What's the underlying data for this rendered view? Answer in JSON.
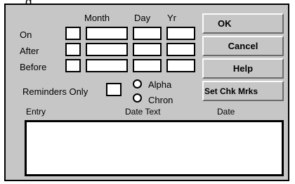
{
  "window": {
    "title_fragment": "g"
  },
  "columns": {
    "month": "Month",
    "day": "Day",
    "year": "Yr"
  },
  "rows": {
    "on": "On",
    "after": "After",
    "before": "Before"
  },
  "inputs": {
    "on": {
      "month": "",
      "day": "",
      "year": ""
    },
    "after": {
      "month": "",
      "day": "",
      "year": ""
    },
    "before": {
      "month": "",
      "day": "",
      "year": ""
    }
  },
  "buttons": {
    "ok": "OK",
    "cancel": "Cancel",
    "help": "Help",
    "set_chk_mrks": "Set Chk Mrks"
  },
  "reminders_only": {
    "label": "Reminders Only",
    "checked": false
  },
  "sort": {
    "alpha": "Alpha",
    "chron": "Chron",
    "selected": ""
  },
  "list": {
    "headers": {
      "entry": "Entry",
      "date_text": "Date Text",
      "date": "Date"
    },
    "items": []
  }
}
